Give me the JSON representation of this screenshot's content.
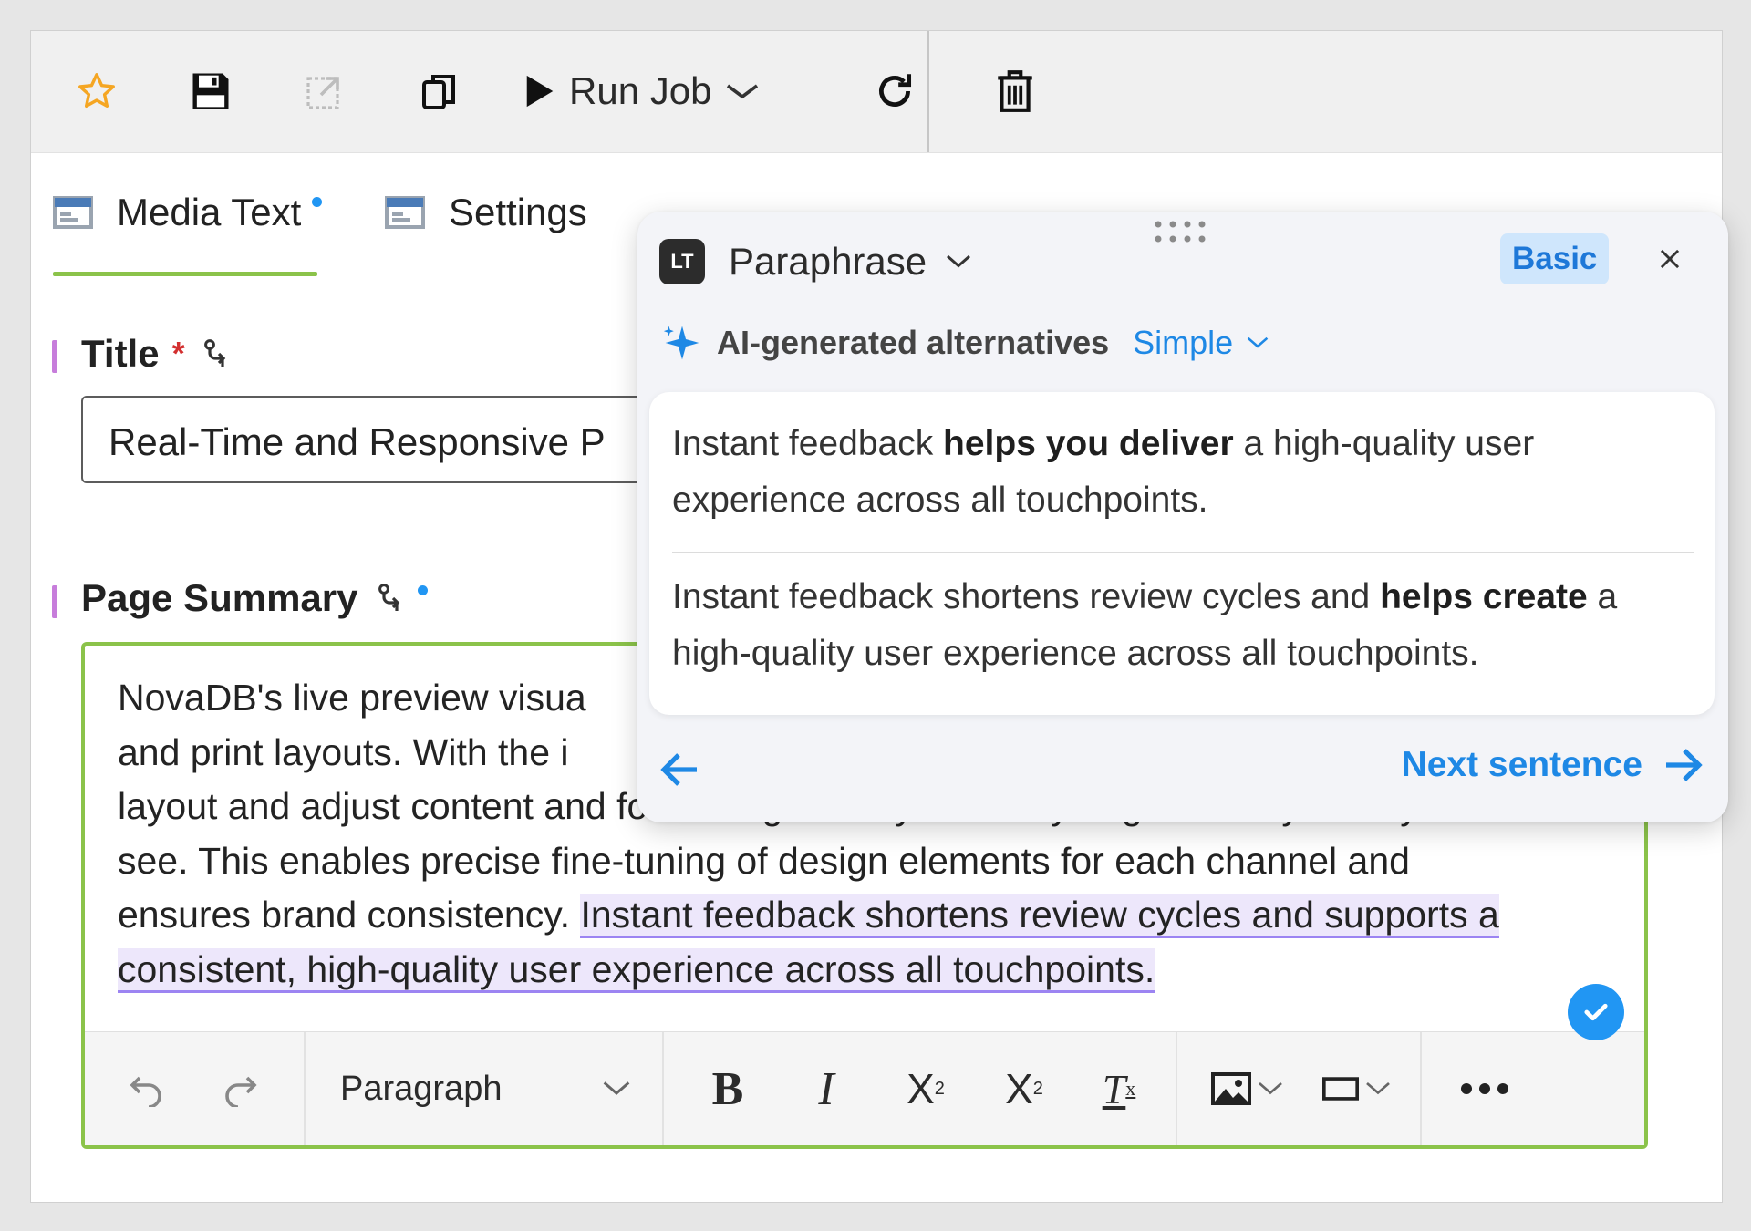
{
  "toolbar": {
    "icons": [
      "star-icon",
      "save-icon",
      "open-external-icon",
      "copy-icon",
      "play-icon",
      "refresh-icon",
      "trash-icon"
    ],
    "run_job_label": "Run Job"
  },
  "tabs": [
    {
      "label": "Media Text",
      "modified": true,
      "active": true
    },
    {
      "label": "Settings",
      "modified": false,
      "active": false
    }
  ],
  "fields": {
    "title": {
      "label": "Title",
      "required_mark": "*",
      "value": "Real-Time and Responsive P"
    },
    "summary": {
      "label": "Page Summary",
      "text_before": "NovaDB's live preview visua",
      "line2": "and print layouts. With the i",
      "line3": "layout and adjust content and formatting as they see it—you get exactly what you",
      "line4": "see. This enables precise fine-tuning of design elements for each channel and",
      "line5_plain": "ensures brand consistency. ",
      "highlight_a": "Instant feedback shortens review cycles and supports a",
      "highlight_b": "consistent, high-quality user experience across all touchpoints."
    }
  },
  "editor_toolbar": {
    "paragraph_label": "Paragraph",
    "buttons": [
      "undo-icon",
      "redo-icon",
      "bold-icon",
      "italic-icon",
      "superscript-icon",
      "subscript-icon",
      "clear-format-icon",
      "image-icon",
      "embed-icon",
      "more-icon"
    ]
  },
  "paraphrase": {
    "title": "Paraphrase",
    "logo_text": "LT",
    "badge": "Basic",
    "subtitle": "AI-generated alternatives",
    "mode": "Simple",
    "alt1": {
      "pre": "Instant feedback ",
      "bold": "helps you deliver",
      "post": " a high-quality user experience across all touchpoints."
    },
    "alt2": {
      "pre": "Instant feedback shortens review cycles and ",
      "bold": "helps create",
      "post": " a high-quality user experience across all touchpoints."
    },
    "next_label": "Next sentence"
  },
  "colors": {
    "accent_green": "#8bc34a",
    "accent_blue": "#1e88e5",
    "highlight": "#ede7fb",
    "label_bar": "#c77ddb"
  }
}
